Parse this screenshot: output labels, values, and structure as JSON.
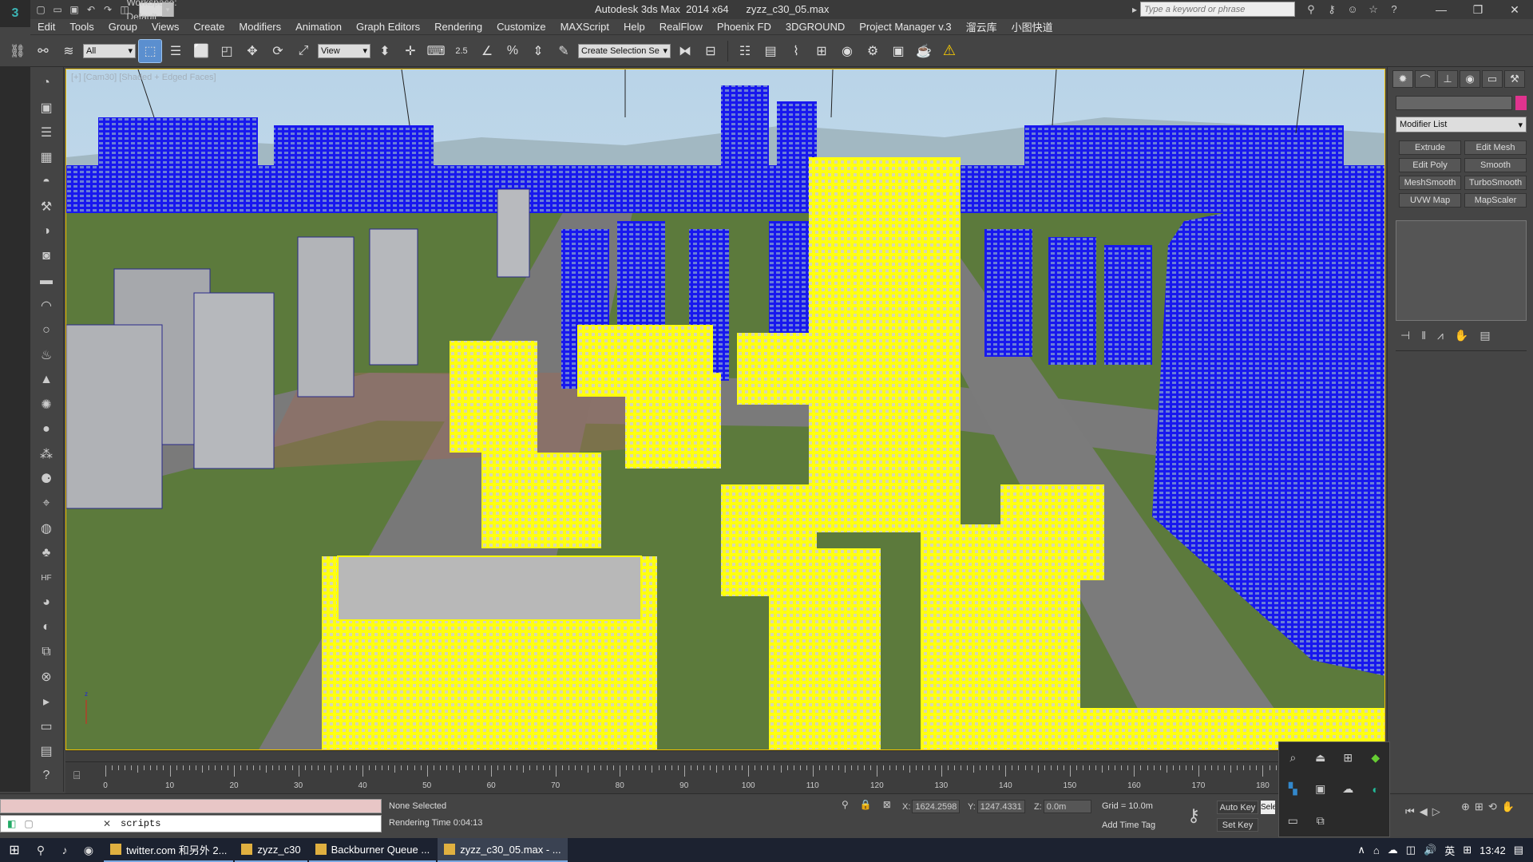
{
  "titlebar": {
    "workspace_label": "Workspace: Default",
    "title": "Autodesk 3ds Max  2014 x64      zyzz_c30_05.max",
    "search_placeholder": "Type a keyword or phrase",
    "icons": [
      "new-icon",
      "open-icon",
      "save-icon",
      "undo-icon",
      "redo-icon",
      "project-icon"
    ]
  },
  "menubar": {
    "items": [
      "Edit",
      "Tools",
      "Group",
      "Views",
      "Create",
      "Modifiers",
      "Animation",
      "Graph Editors",
      "Rendering",
      "Customize",
      "MAXScript",
      "Help",
      "RealFlow",
      "Phoenix FD",
      "3DGROUND",
      "Project Manager v.3",
      "溜云库",
      "小图快道"
    ]
  },
  "toolbar": {
    "filter_value": "All",
    "refcoord_value": "View",
    "selection_set_value": "Create Selection Se",
    "snap_label": "2.5"
  },
  "viewport": {
    "label": "[+] [Cam30] [Shaded + Edged Faces]",
    "selection_color": "#ffff00",
    "blue_color": "#1a1aff"
  },
  "command_panel": {
    "modifier_list": "Modifier List",
    "buttons": [
      "Extrude",
      "Edit Mesh",
      "Edit Poly",
      "Smooth",
      "MeshSmooth",
      "TurboSmooth",
      "UVW Map",
      "MapScaler"
    ]
  },
  "timeline": {
    "ticks": [
      "0",
      "10",
      "20",
      "30",
      "40",
      "50",
      "60",
      "70",
      "80",
      "90",
      "100",
      "110",
      "120",
      "130",
      "140",
      "150",
      "160",
      "170",
      "180"
    ]
  },
  "status": {
    "script_text": "scripts",
    "selection_status": "None Selected",
    "rendering_time": "Rendering Time  0:04:13",
    "x_label": "X:",
    "x_value": "1624.2598",
    "y_label": "Y:",
    "y_value": "1247.4331",
    "z_label": "Z:",
    "z_value": "0.0m",
    "grid": "Grid = 10.0m",
    "add_time_tag": "Add Time Tag",
    "auto_key": "Auto Key",
    "set_key": "Set Key",
    "selected": "Sele"
  },
  "taskbar": {
    "items": [
      {
        "label": "twitter.com 和另外 2..."
      },
      {
        "label": "zyzz_c30"
      },
      {
        "label": "Backburner Queue ..."
      },
      {
        "label": "zyzz_c30_05.max - ..."
      }
    ],
    "lang": "英",
    "time": "13:42"
  }
}
